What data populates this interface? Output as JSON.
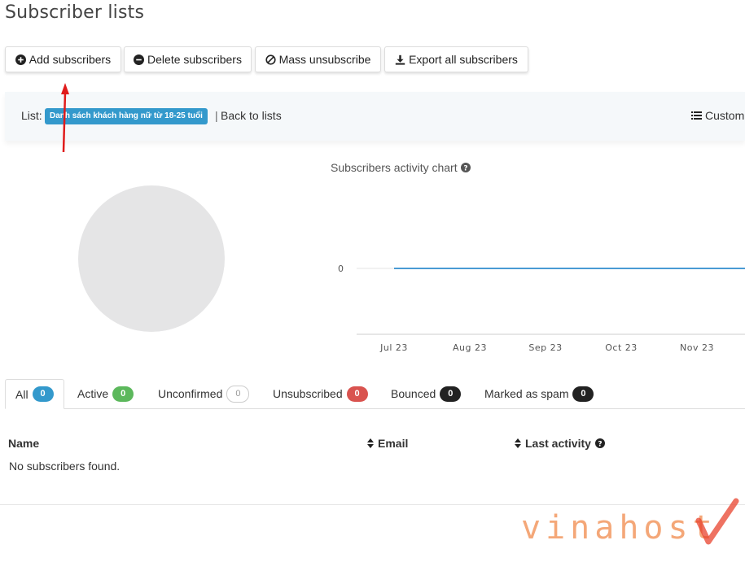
{
  "page": {
    "title": "Subscriber lists"
  },
  "toolbar": {
    "add_label": "Add subscribers",
    "delete_label": "Delete subscribers",
    "unsubscribe_label": "Mass unsubscribe",
    "export_label": "Export all subscribers"
  },
  "list_bar": {
    "list_label": "List:",
    "list_name": "Danh sách khách hàng nữ từ 18-25 tuổi",
    "separator": "|",
    "back_label": "Back to lists",
    "custom_label": "Custom"
  },
  "chart": {
    "title": "Subscribers activity chart"
  },
  "chart_data": {
    "type": "line",
    "title": "Subscribers activity chart",
    "x": [
      "Jul 23",
      "Aug 23",
      "Sep 23",
      "Oct 23",
      "Nov 23"
    ],
    "y_ticks": [
      "0"
    ],
    "series": [
      {
        "values": [
          0,
          0,
          0,
          0,
          0
        ],
        "color": "#4a9bd4"
      }
    ],
    "ylim": [
      0,
      0
    ],
    "grid": true
  },
  "tabs": [
    {
      "label": "All",
      "count": "0",
      "color": "#3399cc"
    },
    {
      "label": "Active",
      "count": "0",
      "color": "#5cb85c"
    },
    {
      "label": "Unconfirmed",
      "count": "0",
      "color": "#ffffff"
    },
    {
      "label": "Unsubscribed",
      "count": "0",
      "color": "#d9534f"
    },
    {
      "label": "Bounced",
      "count": "0",
      "color": "#222222"
    },
    {
      "label": "Marked as spam",
      "count": "0",
      "color": "#222222"
    }
  ],
  "table": {
    "columns": [
      "Name",
      "Email",
      "Last activity"
    ],
    "empty_message": "No subscribers found."
  },
  "watermark": {
    "brand": "vinahost"
  },
  "colors": {
    "accent": "#3399cc",
    "annotation_arrow": "#e01b1b",
    "brand_orange": "#f08a4b"
  }
}
